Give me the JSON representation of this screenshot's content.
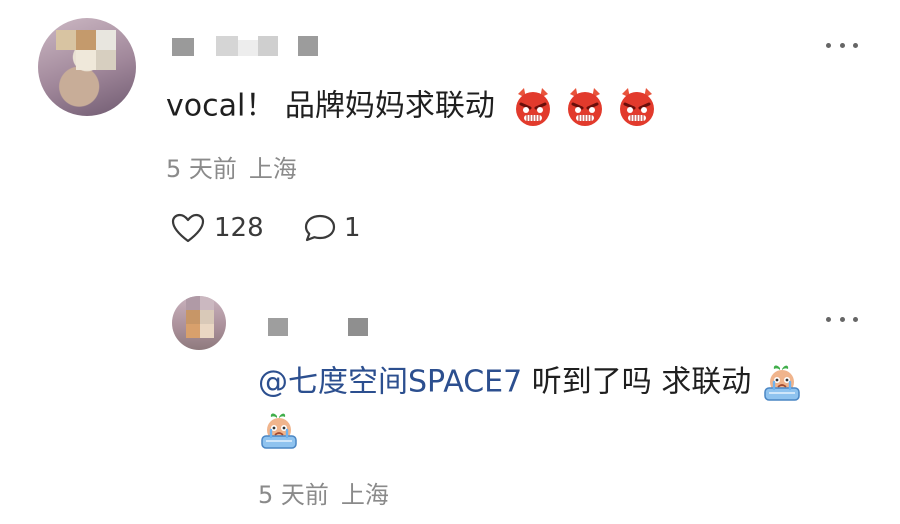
{
  "comment": {
    "text": "vocal！ 品牌妈妈求联动",
    "emoji_count": 3,
    "emoji_icon": "angry-devil-emoji",
    "meta_time": "5 天前",
    "meta_location": "上海",
    "likes": "128",
    "replies": "1",
    "icons": [
      "heart-icon",
      "comment-bubble-icon",
      "more-dots-icon"
    ]
  },
  "reply": {
    "mention": "@七度空间SPACE7",
    "text": " 听到了吗 求联动",
    "emoji_icon": "crying-tub-emoji",
    "meta_time": "5 天前",
    "meta_location": "上海",
    "icons": [
      "more-dots-icon"
    ]
  },
  "colors": {
    "mention": "#2c4f8f",
    "meta": "#8a8a8a",
    "emoji_red": "#e23a2c"
  }
}
